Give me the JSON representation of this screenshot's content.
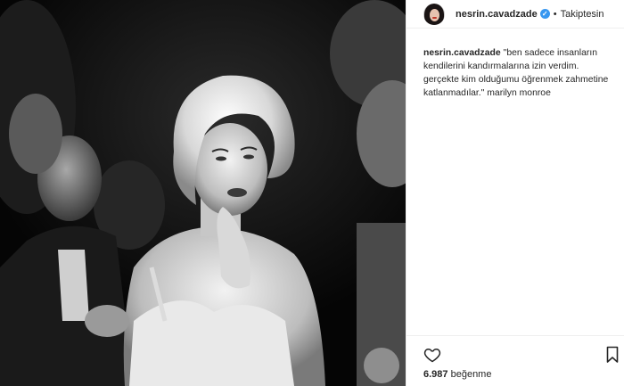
{
  "post": {
    "username": "nesrin.cavadzade",
    "verified_icon": "verified-badge-icon",
    "separator": "•",
    "follow_label": "Takiptesin",
    "caption_user": "nesrin.cavadzade",
    "caption_text": "\"ben sadece insanların kendilerini kandırmalarına izin verdim. gerçekte kim olduğumu öğrenmek zahmetine katlanmadılar.\" marilyn monroe",
    "likes_count": "6.987",
    "likes_label": "beğenme",
    "icons": {
      "like": "heart-icon",
      "save": "bookmark-icon"
    },
    "colors": {
      "verified": "#3897f0",
      "text": "#262626",
      "border": "#efefef"
    }
  }
}
